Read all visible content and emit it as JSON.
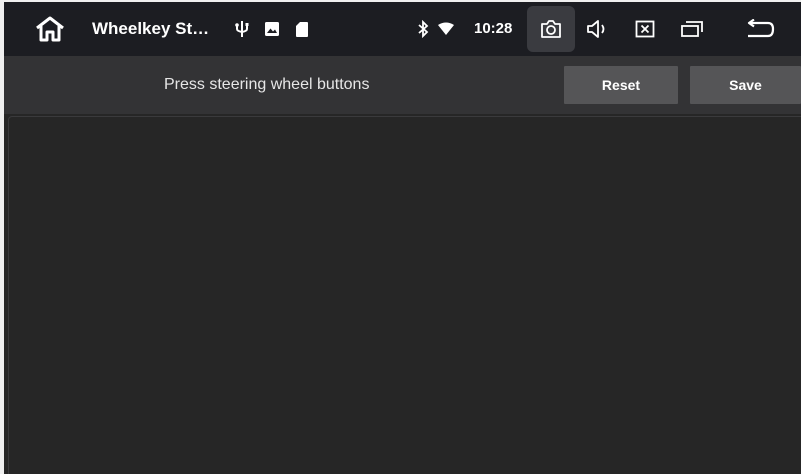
{
  "status_bar": {
    "app_title": "Wheelkey St…",
    "time": "10:28",
    "icons": [
      "home-icon",
      "usb-icon",
      "image-icon",
      "sd-card-icon",
      "bluetooth-icon",
      "wifi-icon",
      "camera-icon",
      "volume-icon",
      "close-box-icon",
      "recents-icon",
      "back-icon"
    ]
  },
  "action_bar": {
    "prompt": "Press steering wheel buttons",
    "reset_label": "Reset",
    "save_label": "Save"
  },
  "colors": {
    "background": "#262626",
    "status_bar": "#1c1d22",
    "action_bar": "#333335",
    "button": "#555557"
  }
}
